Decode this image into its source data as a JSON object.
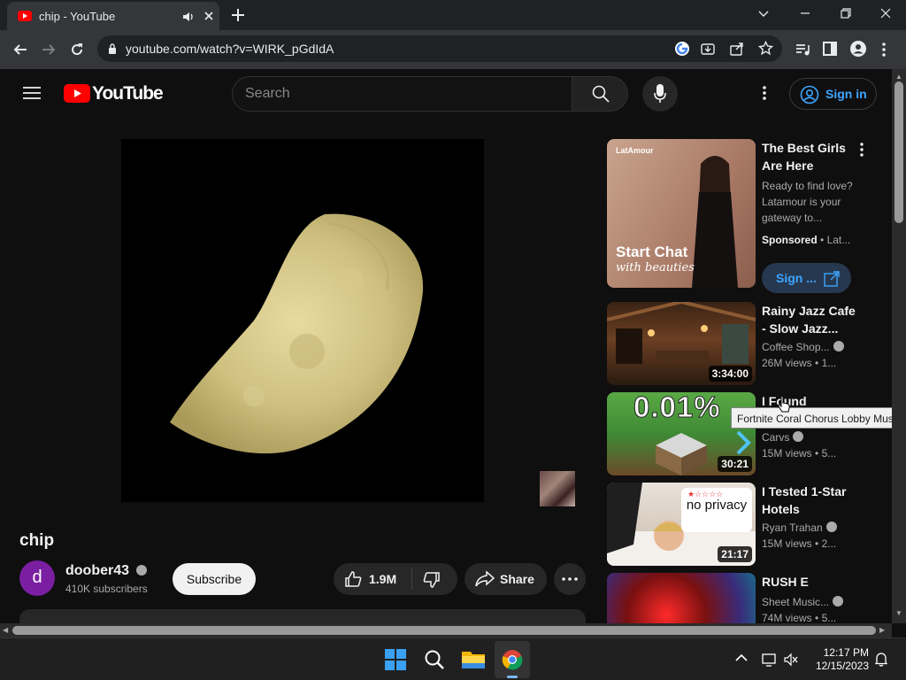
{
  "browser": {
    "tab_title": "chip - YouTube",
    "url": "youtube.com/watch?v=WIRK_pGdIdA"
  },
  "masthead": {
    "logo_text": "YouTube",
    "search_placeholder": "Search",
    "signin_label": "Sign in"
  },
  "video": {
    "title": "chip",
    "channel_avatar_letter": "d",
    "channel_name": "doober43",
    "subscribers": "410K subscribers",
    "subscribe_label": "Subscribe",
    "likes": "1.9M",
    "share_label": "Share"
  },
  "sidebar": {
    "ad": {
      "title": "The Best Girls Are Here",
      "description": "Ready to find love? Latamour is your gateway to...",
      "sponsored": "Sponsored",
      "advertiser": "Lat...",
      "cta": "Sign ...",
      "thumb_brand": "LatAmour",
      "thumb_headline": "Start Chat",
      "thumb_sub": "with beauties"
    },
    "items": [
      {
        "title": "Rainy Jazz Cafe - Slow Jazz...",
        "channel": "Coffee Shop...",
        "views": "26M views",
        "age": "1...",
        "duration": "3:34:00"
      },
      {
        "title": "I Found",
        "channel": "Carvs",
        "views": "15M views",
        "age": "5...",
        "duration": "30:21",
        "thumb_text": "0.01%"
      },
      {
        "title": "I Tested 1-Star Hotels",
        "channel": "Ryan Trahan",
        "views": "15M views",
        "age": "2...",
        "duration": "21:17",
        "thumb_text": "no privacy"
      },
      {
        "title": "RUSH E",
        "channel": "Sheet Music...",
        "views": "74M views",
        "age": "5..."
      }
    ]
  },
  "tooltip": "Fortnite Coral Chorus Lobby Music",
  "taskbar": {
    "time": "12:17 PM",
    "date": "12/15/2023"
  },
  "colors": {
    "youtube_red": "#ff0000",
    "link_blue": "#3ea6ff",
    "background": "#0f0f0f"
  }
}
